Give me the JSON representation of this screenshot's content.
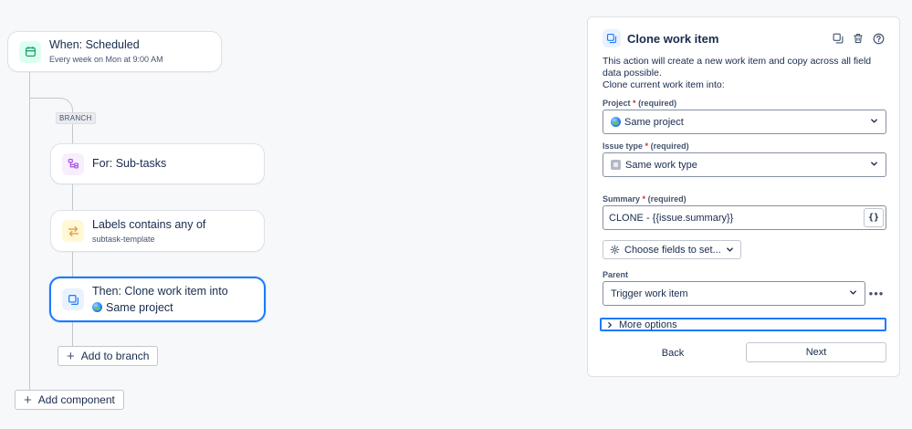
{
  "canvas": {
    "trigger": {
      "title": "When: Scheduled",
      "subtitle": "Every week on Mon at 9:00 AM",
      "icon": "calendar-icon",
      "color": "#22a06b"
    },
    "branch_tag": "BRANCH",
    "for_node": {
      "title": "For: Sub-tasks",
      "icon": "subtasks-icon",
      "color": "#a54fe1"
    },
    "condition_node": {
      "title": "Labels contains any of",
      "subtitle": "subtask-template",
      "icon": "swap-arrows-icon",
      "color": "#e2a03f"
    },
    "action_node": {
      "title": "Then: Clone work item into",
      "subtitle": "Same project",
      "icon": "clone-icon",
      "color": "#1d7afc"
    },
    "add_to_branch": "Add to branch",
    "add_component": "Add component"
  },
  "panel": {
    "title": "Clone work item",
    "header_icons": [
      "duplicate-icon",
      "trash-icon",
      "help-icon"
    ],
    "description_line1": "This action will create a new work item and copy across all field data possible.",
    "description_line2": "Clone current work item into:",
    "project": {
      "label": "Project",
      "required": "*",
      "required_text": "(required)",
      "value": "Same project"
    },
    "issue_type": {
      "label": "Issue type",
      "required": "*",
      "required_text": "(required)",
      "value": "Same work type"
    },
    "summary": {
      "label": "Summary",
      "required": "*",
      "required_text": "(required)",
      "value": "CLONE - {{issue.summary}}",
      "braces": "{}"
    },
    "choose_fields": "Choose fields to set...",
    "parent": {
      "label": "Parent",
      "value": "Trigger work item"
    },
    "more_options": "More options",
    "back": "Back",
    "next": "Next"
  }
}
